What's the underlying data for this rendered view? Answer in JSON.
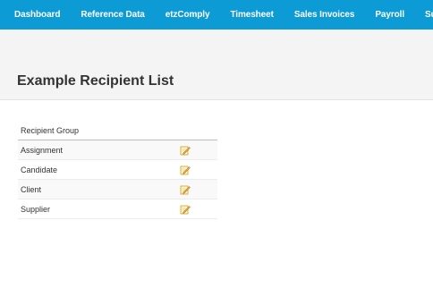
{
  "nav": {
    "items": [
      {
        "label": "Dashboard"
      },
      {
        "label": "Reference Data"
      },
      {
        "label": "etzComply"
      },
      {
        "label": "Timesheet"
      },
      {
        "label": "Sales Invoices"
      },
      {
        "label": "Payroll"
      },
      {
        "label": "Sup"
      }
    ]
  },
  "page": {
    "title": "Example Recipient List"
  },
  "table": {
    "header": "Recipient Group",
    "rows": [
      {
        "label": "Assignment",
        "action_icon": "edit-icon"
      },
      {
        "label": "Candidate",
        "action_icon": "edit-icon"
      },
      {
        "label": "Client",
        "action_icon": "edit-icon"
      },
      {
        "label": "Supplier",
        "action_icon": "edit-icon"
      }
    ]
  },
  "colors": {
    "nav_bg": "#0d9bd6",
    "nav_text": "#ffffff",
    "header_band": "#f4f4f4",
    "title_text": "#333333"
  }
}
